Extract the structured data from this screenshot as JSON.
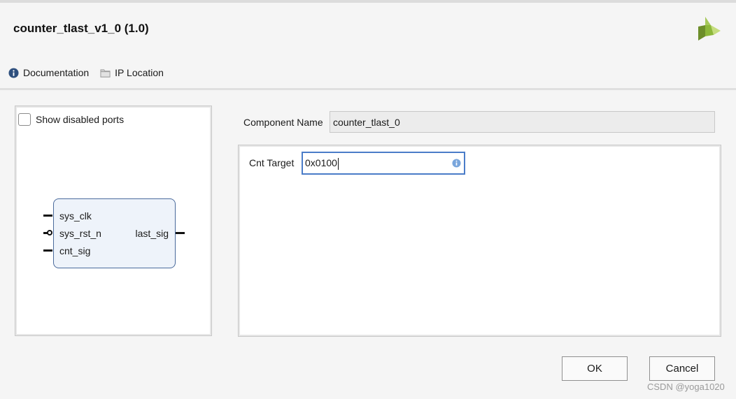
{
  "header": {
    "title": "counter_tlast_v1_0 (1.0)",
    "logo_icon": "xilinx-logo-icon"
  },
  "toolbar": {
    "documentation_label": "Documentation",
    "documentation_icon": "info-icon",
    "ip_location_label": "IP Location",
    "ip_location_icon": "folder-icon"
  },
  "symbol_panel": {
    "show_disabled_ports_label": "Show disabled ports",
    "show_disabled_ports_checked": false,
    "inputs": [
      "sys_clk",
      "sys_rst_n",
      "cnt_sig"
    ],
    "outputs": [
      "last_sig"
    ]
  },
  "component": {
    "label": "Component Name",
    "value": "counter_tlast_0"
  },
  "params": {
    "cnt_target_label": "Cnt Target",
    "cnt_target_value": "0x0100"
  },
  "buttons": {
    "ok_label": "OK",
    "cancel_label": "Cancel"
  },
  "watermark": "CSDN @yoga1020",
  "colors": {
    "accent": "#4a7cc8",
    "block_border": "#4a6a9c",
    "block_fill": "#eef3fa",
    "logo_green": "#8db83a"
  }
}
